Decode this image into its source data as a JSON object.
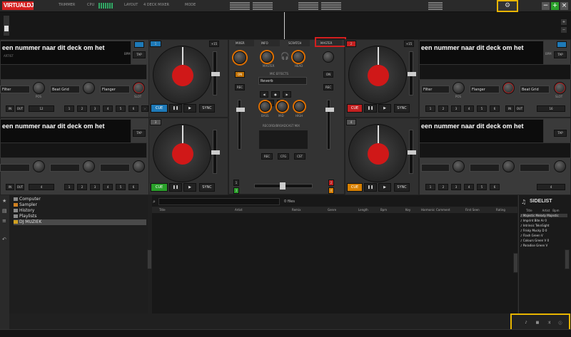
{
  "topbar": {
    "logo": "VIRTUALDJ",
    "mode": "TRIMMER",
    "cpu_label": "CPU",
    "layout_label": "LAYOUT",
    "layout_value": "4 DECK MIXER",
    "mode_label": "MODE",
    "settings_icon": "gear-icon",
    "colors": {
      "brand": "#d41f1f",
      "highlight": "#e8b500"
    }
  },
  "decks": {
    "left_top": {
      "title": "een nummer naar dit deck om het",
      "bpm": "BPM",
      "tap": "TAP",
      "filter": "Filter",
      "fx2": "Beat Grid",
      "fx2b": "Flanger",
      "pos": "POS",
      "slot": "SLOT",
      "cue": "CUE",
      "sync": "SYNC",
      "pitch_plus": "+15",
      "loop_value": "12",
      "num": "1"
    },
    "left_bottom": {
      "title": "een nummer naar dit deck om het",
      "cue": "CUE",
      "sync": "SYNC",
      "num": "3"
    },
    "right_top": {
      "title": "een nummer naar dit deck om het",
      "bpm": "BPM",
      "tap": "TAP",
      "filter": "Filter",
      "fx2": "Flanger",
      "fx2b": "Beat Grid",
      "pos": "POS",
      "slot": "SLOT",
      "cue": "CUE",
      "sync": "SYNC",
      "pitch_plus": "+15",
      "loop_value": "16",
      "num": "2"
    },
    "right_bottom": {
      "title": "een nummer naar dit deck om het",
      "cue": "CUE",
      "sync": "SYNC",
      "num": "4"
    }
  },
  "mixer": {
    "tabs": [
      "MIXER",
      "INFO",
      "SCRATCH",
      "MASTER"
    ],
    "master_vol": "MASTER",
    "head_vol": "HEAD",
    "mic": "MIC",
    "fx_label": "MIC EFFECTS",
    "fx_value": "Reverb",
    "eq": [
      "BASS",
      "MID",
      "HIGH"
    ],
    "rec_label": "RECORD/BROADCAST MIX",
    "rec_buttons": [
      "REC",
      "CFG",
      "CST"
    ],
    "on": "ON",
    "rec": "REC",
    "deck_nums": [
      "1",
      "3",
      "2",
      "4"
    ]
  },
  "browser": {
    "tree": [
      {
        "label": "Computer",
        "color": "#8a8a8a"
      },
      {
        "label": "Sampler",
        "color": "#d08020"
      },
      {
        "label": "History",
        "color": "#8a8a8a"
      },
      {
        "label": "Playlists",
        "color": "#8a8a8a"
      },
      {
        "label": "DJ MUZIEK",
        "color": "#d0a020"
      }
    ],
    "search_placeholder": "",
    "file_count": "0 files",
    "columns": [
      "Title",
      "Artist",
      "Remix",
      "Genre",
      "Length",
      "Bpm",
      "Key",
      "Harmonic",
      "Comment",
      "First Seen",
      "Rating"
    ],
    "sidelist": {
      "title": "SIDELIST",
      "columns": [
        "Title",
        "Artist",
        "Bpm"
      ],
      "rows": [
        {
          "title": "Majestic Melody",
          "artist": "Majestic",
          "bpm": ""
        },
        {
          "title": "Imprint",
          "artist": "Bite Ar",
          "bpm": "0"
        },
        {
          "title": "Intrinsic",
          "artist": "TeknSight",
          "bpm": ""
        },
        {
          "title": "Frisky",
          "artist": "Mucky D",
          "bpm": "0"
        },
        {
          "title": "Flash",
          "artist": "Green V",
          "bpm": ""
        },
        {
          "title": "Colours",
          "artist": "Green V",
          "bpm": "0"
        },
        {
          "title": "Paradise",
          "artist": "Green V",
          "bpm": ""
        }
      ]
    },
    "side_tab_left": "Folders",
    "side_tab_right": "Sidelist"
  }
}
